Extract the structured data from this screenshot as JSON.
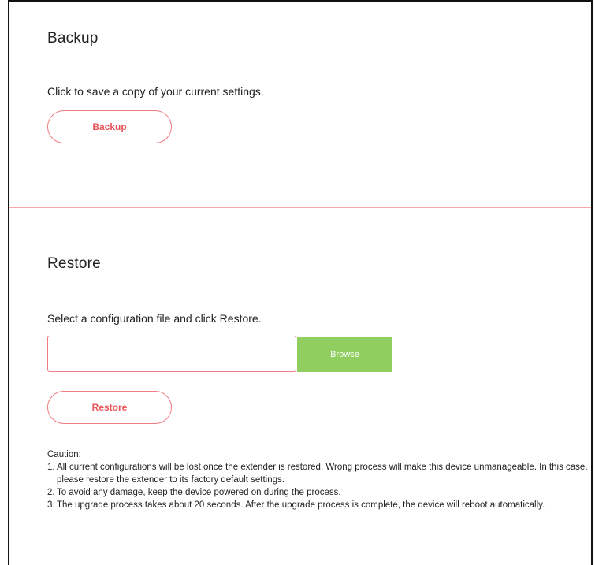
{
  "backup": {
    "title": "Backup",
    "description": "Click to save a copy of your current settings.",
    "button_label": "Backup"
  },
  "restore": {
    "title": "Restore",
    "description": "Select a configuration file and click Restore.",
    "file_input_value": "",
    "browse_label": "Browse",
    "button_label": "Restore"
  },
  "caution": {
    "heading": "Caution:",
    "items": [
      {
        "num": "1.",
        "text": "All current configurations will be lost once the extender is restored. Wrong process will make this device unmanageable. In this case, please restore the extender to its factory default settings."
      },
      {
        "num": "2.",
        "text": "To avoid any damage, keep the device powered on during the process."
      },
      {
        "num": "3.",
        "text": "The upgrade process takes about 20 seconds. After the upgrade process is complete, the device will reboot automatically."
      }
    ]
  },
  "colors": {
    "accent": "#f07b80",
    "accent_text": "#e8555b",
    "browse_green": "#8fce5f",
    "divider": "#f7a5a8"
  }
}
